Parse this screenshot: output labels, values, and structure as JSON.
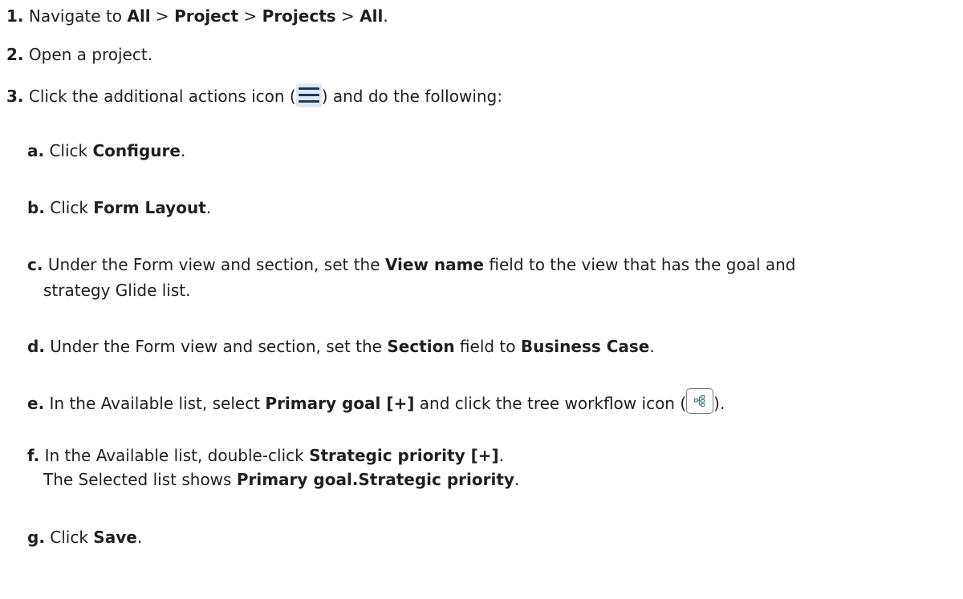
{
  "steps": [
    {
      "num": "1.",
      "parts": [
        "Navigate to ",
        "All",
        " > ",
        "Project",
        " > ",
        "Projects",
        " > ",
        "All",
        "."
      ]
    },
    {
      "num": "2.",
      "text": "Open a project."
    },
    {
      "num": "3.",
      "before": "Click the additional actions icon (",
      "after": ") and do the following:"
    }
  ],
  "substeps": [
    {
      "label": "a.",
      "before": "Click ",
      "bold": "Configure",
      "after": "."
    },
    {
      "label": "b.",
      "before": "Click ",
      "bold": "Form Layout",
      "after": "."
    },
    {
      "label": "c.",
      "before": "Under the Form view and section, set the ",
      "bold": "View name",
      "after": " field to the view that has the goal and",
      "line2": "strategy Glide list."
    },
    {
      "label": "d.",
      "before": "Under the Form view and section, set the ",
      "bold": "Section",
      "mid": " field to ",
      "bold2": "Business Case",
      "after": "."
    },
    {
      "label": "e.",
      "before": "In the Available list, select ",
      "bold": "Primary goal [+]",
      "mid": " and click the tree workflow icon (",
      "after": ")."
    },
    {
      "label": "f.",
      "before": "In the Available list, double-click ",
      "bold": "Strategic priority [+]",
      "after": ".",
      "line2_before": "The Selected list shows ",
      "line2_bold": "Primary goal.Strategic priority",
      "line2_after": "."
    },
    {
      "label": "g.",
      "before": "Click ",
      "bold": "Save",
      "after": "."
    }
  ],
  "icons": {
    "menu": "hamburger-menu-icon",
    "tree": "tree-workflow-icon",
    "menu_bg": "#dfe9f3",
    "menu_fg": "#1a3a5c",
    "tree_fg": "#2f6f8f"
  }
}
